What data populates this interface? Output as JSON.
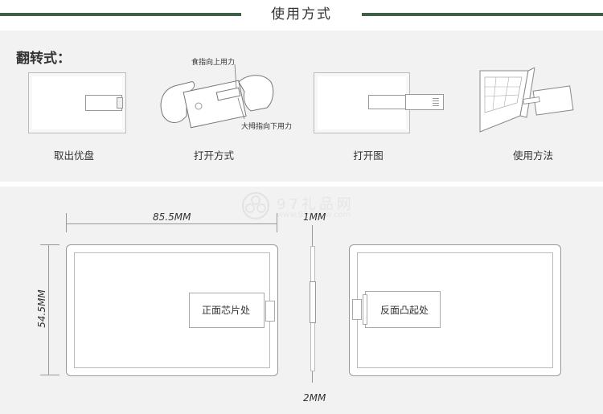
{
  "header": {
    "title": "使用方式"
  },
  "top": {
    "flip_label": "翻转式：",
    "captions": [
      "取出优盘",
      "打开方式",
      "打开图",
      "使用方法"
    ],
    "hand_labels": {
      "index_finger": "食指向上用力",
      "thumb": "大拇指向下用力"
    }
  },
  "dims": {
    "width": "85.5MM",
    "height": "54.5MM",
    "thickness_top": "1MM",
    "thickness_bottom": "2MM"
  },
  "labels": {
    "front": "正面芯片处",
    "back": "反面凸起处"
  },
  "watermark": {
    "name": "97礼品网",
    "url": "www.97lipinw.com"
  },
  "colors": {
    "header_line": "#3f5f49",
    "panel_bg": "#f2f2f2"
  }
}
